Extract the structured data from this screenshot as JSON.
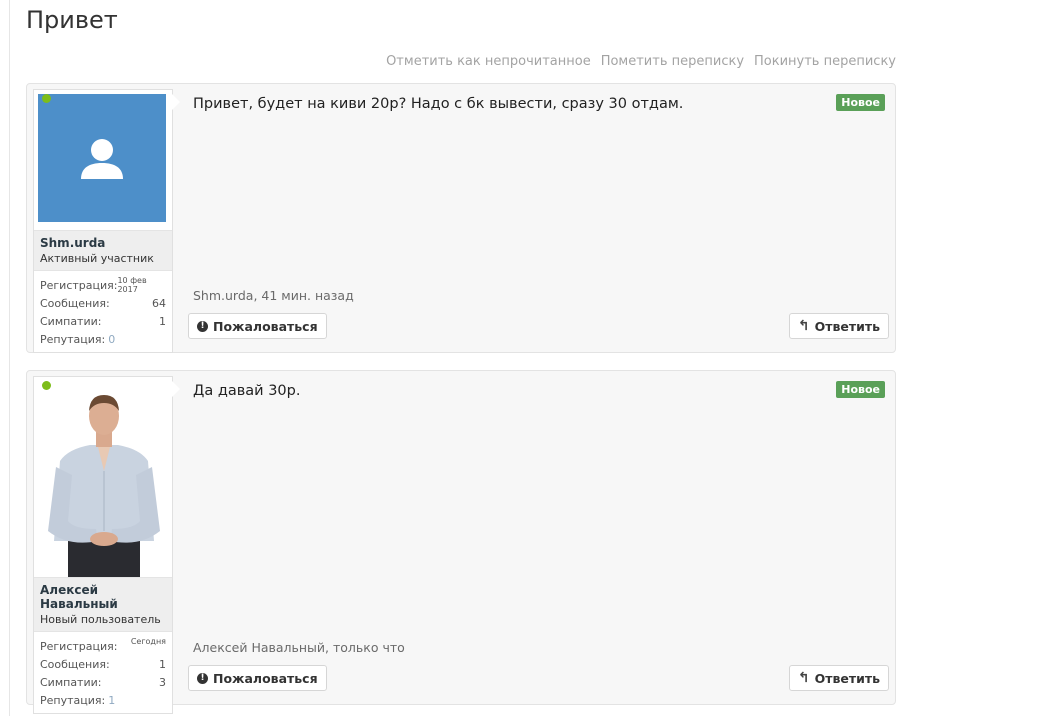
{
  "page": {
    "title": "Привет"
  },
  "conversation_actions": [
    "Отметить как непрочитанное",
    "Пометить переписку",
    "Покинуть переписку"
  ],
  "messages": [
    {
      "username": "Shm.urda",
      "user_title": "Активный участник",
      "online": true,
      "avatar": "default-avatar-icon",
      "stats": {
        "registration_label": "Регистрация:",
        "registration_value": "10 фев 2017",
        "messages_label": "Сообщения:",
        "messages_value": "64",
        "likes_label": "Симпатии:",
        "likes_value": "1",
        "reputation_label": "Репутация:",
        "reputation_value": "0"
      },
      "text": "Привет, будет на киви 20р? Надо с бк вывести, сразу 30 отдам.",
      "badge": "Новое",
      "meta": "Shm.urda, 41 мин. назад",
      "report_label": "Пожаловаться",
      "reply_label": "Ответить"
    },
    {
      "username": "Алексей Навальный",
      "user_title": "Новый пользователь",
      "online": true,
      "avatar": "user-photo",
      "stats": {
        "registration_label": "Регистрация:",
        "registration_value": "Сегодня",
        "messages_label": "Сообщения:",
        "messages_value": "1",
        "likes_label": "Симпатии:",
        "likes_value": "3",
        "reputation_label": "Репутация:",
        "reputation_value": "1"
      },
      "text": "Да давай 30р.",
      "badge": "Новое",
      "meta": "Алексей Навальный, только что",
      "report_label": "Пожаловаться",
      "reply_label": "Ответить"
    }
  ],
  "colors": {
    "badge_new": "#5aa058",
    "avatar_default_bg": "#4d8fc9",
    "online_dot": "#7dbd1a",
    "action_link": "#a3a3a3"
  }
}
